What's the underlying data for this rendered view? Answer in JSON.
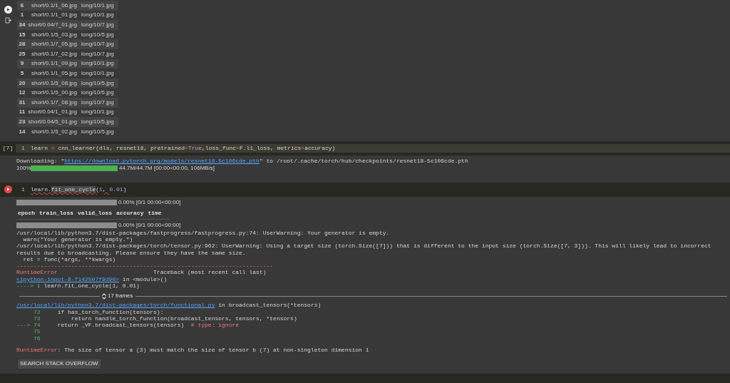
{
  "output_table": {
    "rows": [
      {
        "index": "6",
        "short": "short/0.1/1_06.jpg",
        "long": "long/10/1.jpg"
      },
      {
        "index": "1",
        "short": "short/0.1/1_01.jpg",
        "long": "long/10/1.jpg"
      },
      {
        "index": "34",
        "short": "short/0.04/7_01.jpg",
        "long": "long/10/7.jpg"
      },
      {
        "index": "15",
        "short": "short/0.1/5_03.jpg",
        "long": "long/10/5.jpg"
      },
      {
        "index": "28",
        "short": "short/0.1/7_05.jpg",
        "long": "long/10/7.jpg"
      },
      {
        "index": "25",
        "short": "short/0.1/7_02.jpg",
        "long": "long/10/7.jpg"
      },
      {
        "index": "9",
        "short": "short/0.1/1_09.jpg",
        "long": "long/10/1.jpg"
      },
      {
        "index": "5",
        "short": "short/0.1/1_05.jpg",
        "long": "long/10/1.jpg"
      },
      {
        "index": "20",
        "short": "short/0.1/5_08.jpg",
        "long": "long/10/5.jpg"
      },
      {
        "index": "12",
        "short": "short/0.1/5_00.jpg",
        "long": "long/10/5.jpg"
      },
      {
        "index": "31",
        "short": "short/0.1/7_08.jpg",
        "long": "long/10/7.jpg"
      },
      {
        "index": "11",
        "short": "short/0.04/1_01.jpg",
        "long": "long/10/1.jpg"
      },
      {
        "index": "23",
        "short": "short/0.04/5_01.jpg",
        "long": "long/10/5.jpg"
      },
      {
        "index": "14",
        "short": "short/0.1/5_02.jpg",
        "long": "long/10/5.jpg"
      }
    ]
  },
  "cells": [
    {
      "kind": "executed",
      "prompt": "[7]",
      "line_number": "1",
      "current_line": true,
      "code": [
        {
          "text": "learn ",
          "kind": "plain"
        },
        {
          "text": "=",
          "kind": "operator"
        },
        {
          "text": " cnn_learner(dls, resnet18, pretrained",
          "kind": "plain"
        },
        {
          "text": "=",
          "kind": "operator"
        },
        {
          "text": "True",
          "kind": "keyword"
        },
        {
          "text": ",loss_func",
          "kind": "plain"
        },
        {
          "text": "=",
          "kind": "operator"
        },
        {
          "text": "F.l1_loss, metrics",
          "kind": "plain"
        },
        {
          "text": "=",
          "kind": "operator"
        },
        {
          "text": "accuracy)",
          "kind": "plain"
        }
      ],
      "output": [
        {
          "kind": "text",
          "tokens": [
            {
              "text": "Downloading: \"",
              "kind": "plain"
            },
            {
              "text": "https://download.pytorch.org/models/resnet18-5c106cde.pth",
              "kind": "link"
            },
            {
              "text": "\" to /root/.cache/torch/hub/checkpoints/resnet18-5c106cde.pth",
              "kind": "plain"
            }
          ]
        },
        {
          "kind": "progress",
          "percent": "100%",
          "level": 1,
          "status": "44.7M/44.7M [00:00<00:00, 106MB/s]"
        }
      ]
    },
    {
      "kind": "error",
      "line_number": "1",
      "current_line": false,
      "code": [
        {
          "text": "learn.",
          "kind": "squiggle"
        },
        {
          "text": "fit_one_cycle",
          "kind": "highlight"
        },
        {
          "text": "(",
          "kind": "squiggle"
        },
        {
          "text": "1",
          "kind": "number"
        },
        {
          "text": ", ",
          "kind": "squiggle"
        },
        {
          "text": "0.01",
          "kind": "number"
        },
        {
          "text": ")",
          "kind": "plain"
        }
      ],
      "output": [
        {
          "kind": "progress",
          "level": 0,
          "status": "0.00% [0/1 00:00<00:00]"
        },
        {
          "kind": "table_header",
          "columns": [
            "epoch",
            "train_loss",
            "valid_loss",
            "accuracy",
            "time"
          ]
        },
        {
          "kind": "progress",
          "level": 0,
          "status": "0.00% [0/1 00:00<00:00]"
        },
        {
          "kind": "text",
          "tokens": [
            {
              "text": "/usr/local/lib/python3.7/dist-packages/fastprogress/fastprogress.py:74: UserWarning: Your generator is empty.",
              "kind": "plain"
            }
          ]
        },
        {
          "kind": "text",
          "tokens": [
            {
              "text": "  warn(\"Your generator is empty.\")",
              "kind": "plain"
            }
          ]
        },
        {
          "kind": "text",
          "tokens": [
            {
              "text": "/usr/local/lib/python3.7/dist-packages/torch/tensor.py:962: UserWarning: Using a target size (torch.Size([7])) that is different to the input size (torch.Size([7, 3])). This will likely lead to incorrect results due to broadcasting. Please ensure they have the same size.",
              "kind": "plain"
            }
          ]
        },
        {
          "kind": "text",
          "tokens": [
            {
              "text": "  ret = func(*args, **kwargs)",
              "kind": "plain"
            }
          ]
        },
        {
          "kind": "text",
          "tokens": [
            {
              "text": "---------------------------------------------------------------------------",
              "kind": "error"
            }
          ]
        },
        {
          "kind": "text",
          "tokens": [
            {
              "text": "RuntimeError",
              "kind": "error"
            },
            {
              "text": "                            Traceback (most recent call last)",
              "kind": "plain"
            }
          ]
        },
        {
          "kind": "text",
          "tokens": [
            {
              "text": "<ipython-input-8-f142507f9d90>",
              "kind": "link"
            },
            {
              "text": " in <module>()",
              "kind": "plain"
            }
          ]
        },
        {
          "kind": "text",
          "tokens": [
            {
              "text": "----> 1 ",
              "kind": "green"
            },
            {
              "text": "learn.fit_one_cycle(1, 0.01)",
              "kind": "plain"
            }
          ]
        },
        {
          "kind": "frames",
          "label": "17 frames"
        },
        {
          "kind": "text",
          "tokens": [
            {
              "text": "/usr/local/lib/python3.7/dist-packages/torch/functional.py",
              "kind": "link"
            },
            {
              "text": " in broadcast_tensors(*tensors)",
              "kind": "plain"
            }
          ]
        },
        {
          "kind": "text",
          "tokens": [
            {
              "text": "     72 ",
              "kind": "green"
            },
            {
              "text": "    if has_torch_function(tensors):",
              "kind": "plain"
            }
          ]
        },
        {
          "kind": "text",
          "tokens": [
            {
              "text": "     73 ",
              "kind": "green"
            },
            {
              "text": "        return handle_torch_function(broadcast_tensors, tensors, *tensors)",
              "kind": "plain"
            }
          ]
        },
        {
          "kind": "text",
          "tokens": [
            {
              "text": "---> 74 ",
              "kind": "green"
            },
            {
              "text": "    return _VF.broadcast_tensors(tensors)  ",
              "kind": "plain"
            },
            {
              "text": "# type: ignore",
              "kind": "error"
            }
          ]
        },
        {
          "kind": "text",
          "tokens": [
            {
              "text": "     75",
              "kind": "green"
            }
          ]
        },
        {
          "kind": "text",
          "tokens": [
            {
              "text": "     76",
              "kind": "green"
            }
          ]
        },
        {
          "kind": "spacer"
        },
        {
          "kind": "text",
          "tokens": [
            {
              "text": "RuntimeError",
              "kind": "error"
            },
            {
              "text": ": The size of tensor a (3) must match the size of tensor b (7) at non-singleton dimension 1",
              "kind": "plain"
            }
          ]
        },
        {
          "kind": "button",
          "label": "SEARCH STACK OVERFLOW"
        }
      ]
    }
  ]
}
